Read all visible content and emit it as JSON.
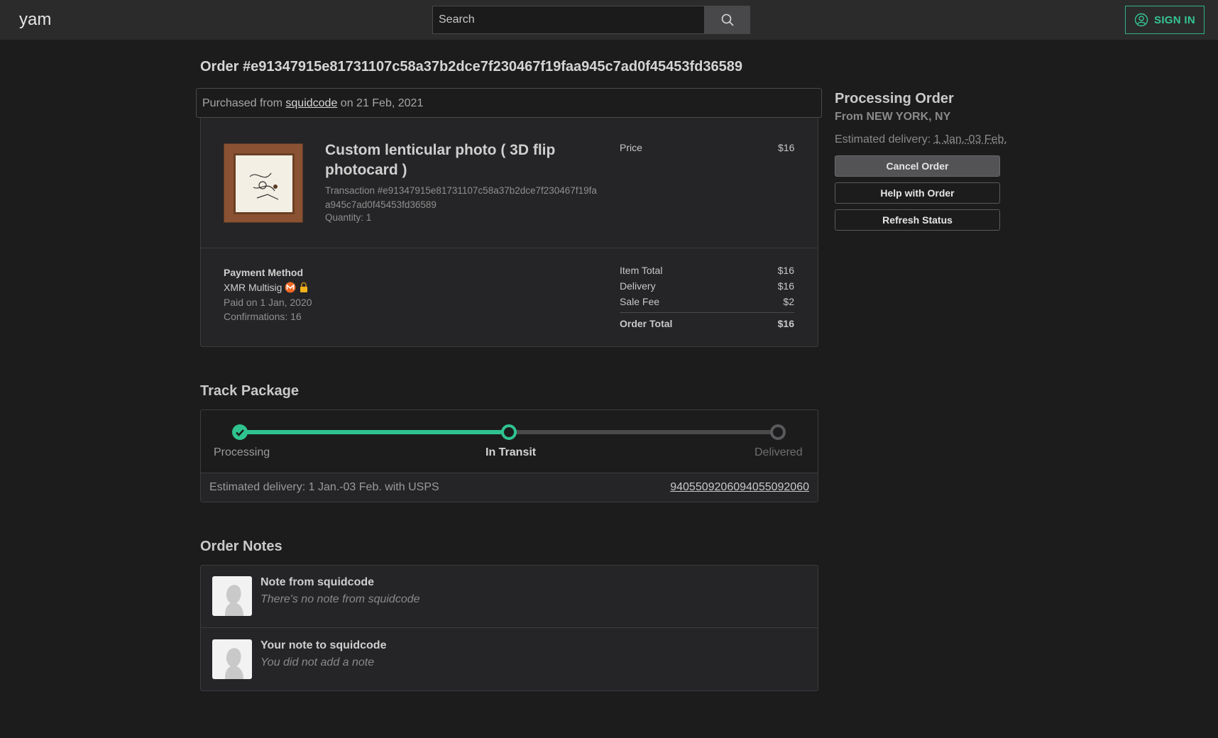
{
  "header": {
    "logo": "yam",
    "search_placeholder": "Search",
    "sign_in": "SIGN IN"
  },
  "order": {
    "title": "Order #e91347915e81731107c58a37b2dce7f230467f19faa945c7ad0f45453fd36589",
    "purchased_prefix": "Purchased from",
    "seller": "squidcode",
    "purchased_suffix": "on 21 Feb, 2021",
    "item_title": "Custom lenticular photo ( 3D flip photocard )",
    "transaction": "Transaction #e91347915e81731107c58a37b2dce7f230467f19faa945c7ad0f45453fd36589",
    "quantity": "Quantity: 1",
    "price_label": "Price",
    "price_value": "$16"
  },
  "payment": {
    "title": "Payment Method",
    "method": "XMR Multisig",
    "paid_on": "Paid on 1 Jan, 2020",
    "confirmations": "Confirmations: 16"
  },
  "summary": {
    "item_total_label": "Item Total",
    "item_total": "$16",
    "delivery_label": "Delivery",
    "delivery": "$16",
    "sale_fee_label": "Sale Fee",
    "sale_fee": "$2",
    "order_total_label": "Order Total",
    "order_total": "$16"
  },
  "status": {
    "title": "Processing Order",
    "from": "From NEW YORK, NY",
    "est_prefix": "Estimated delivery:",
    "est_dates": "1 Jan.-03 Feb.",
    "cancel": "Cancel Order",
    "help": "Help with Order",
    "refresh": "Refresh Status"
  },
  "tracking": {
    "title": "Track Package",
    "steps": [
      "Processing",
      "In Transit",
      "Delivered"
    ],
    "progress_fraction": 0.5,
    "footer": "Estimated delivery: 1 Jan.-03 Feb. with USPS",
    "tracking_number": "9405509206094055092060",
    "accent": "#2fc38f"
  },
  "notes": {
    "title": "Order Notes",
    "seller_note_title": "Note from squidcode",
    "seller_note_body": "There's no note from squidcode",
    "buyer_note_title": "Your note to squidcode",
    "buyer_note_body": "You did not add a note"
  }
}
